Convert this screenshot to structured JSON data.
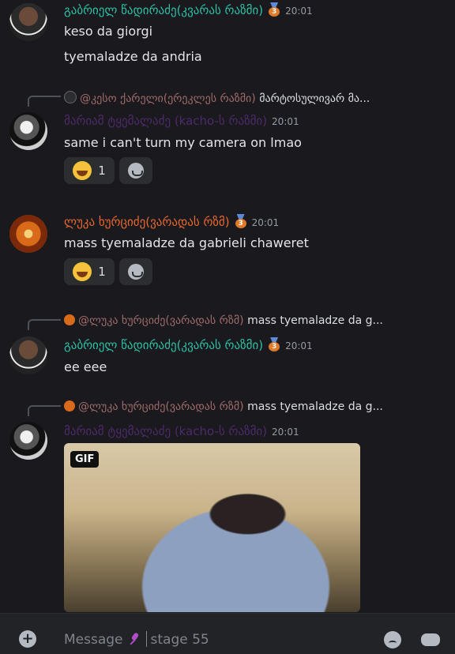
{
  "messages": [
    {
      "author": "გაბრიელ წადირაძე(კვარას რაზმი)",
      "time": "20:01",
      "lines": [
        "keso da giorgi",
        "tyemaladze da andria"
      ]
    },
    {
      "reply_to": {
        "name": "@კესო ქარელი(ერეკლეს რაზმი)",
        "text": "მარტოსულივარ მა..."
      },
      "author": "მარიამ ტყემალაძე (kacho-ს რაზმი)",
      "time": "20:01",
      "lines": [
        "same i can't turn my camera on lmao"
      ],
      "reaction": {
        "count": "1"
      }
    },
    {
      "author": "ლუკა ხურციძე(ვარადას რზმ)",
      "time": "20:01",
      "lines": [
        "mass tyemaladze da gabrieli chaweret"
      ],
      "reaction": {
        "count": "1"
      }
    },
    {
      "reply_to": {
        "name": "@ლუკა ხურციძე(ვარადას რზმ)",
        "text": "mass tyemaladze da g..."
      },
      "author": "გაბრიელ წადირაძე(კვარას რაზმი)",
      "time": "20:01",
      "lines": [
        "ee eee"
      ]
    },
    {
      "reply_to": {
        "name": "@ლუკა ხურციძე(ვარადას რზმ)",
        "text": "mass tyemaladze da g..."
      },
      "author": "მარიამ ტყემალაძე (kacho-ს რაზმი)",
      "time": "20:01",
      "attachment": {
        "badge": "GIF"
      }
    }
  ],
  "composer": {
    "placeholder": "Message",
    "channel": "stage 55"
  },
  "colors": {
    "background": "#1a1a1e",
    "green_role": "#2bc0a5",
    "orange_role": "#e8672e",
    "purple_role": "#4b2a6a"
  }
}
